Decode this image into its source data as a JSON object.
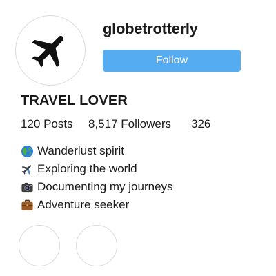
{
  "profile": {
    "username": "globetrotterly",
    "display_name": "TRAVEL LOVER",
    "avatar_icon": "airplane-icon"
  },
  "actions": {
    "follow_label": "Follow",
    "follow_color": "#55acf0"
  },
  "stats": {
    "posts": "120 Posts",
    "followers": "8,517 Followers",
    "following": "326"
  },
  "bio": [
    {
      "icon": "globe-icon",
      "text": "Wanderlust spirit"
    },
    {
      "icon": "airplane-icon",
      "text": "Exploring the world"
    },
    {
      "icon": "camera-icon",
      "text": "Documenting my journeys"
    },
    {
      "icon": "briefcase-icon",
      "text": "Adventure seeker"
    }
  ],
  "highlights_count": 2
}
